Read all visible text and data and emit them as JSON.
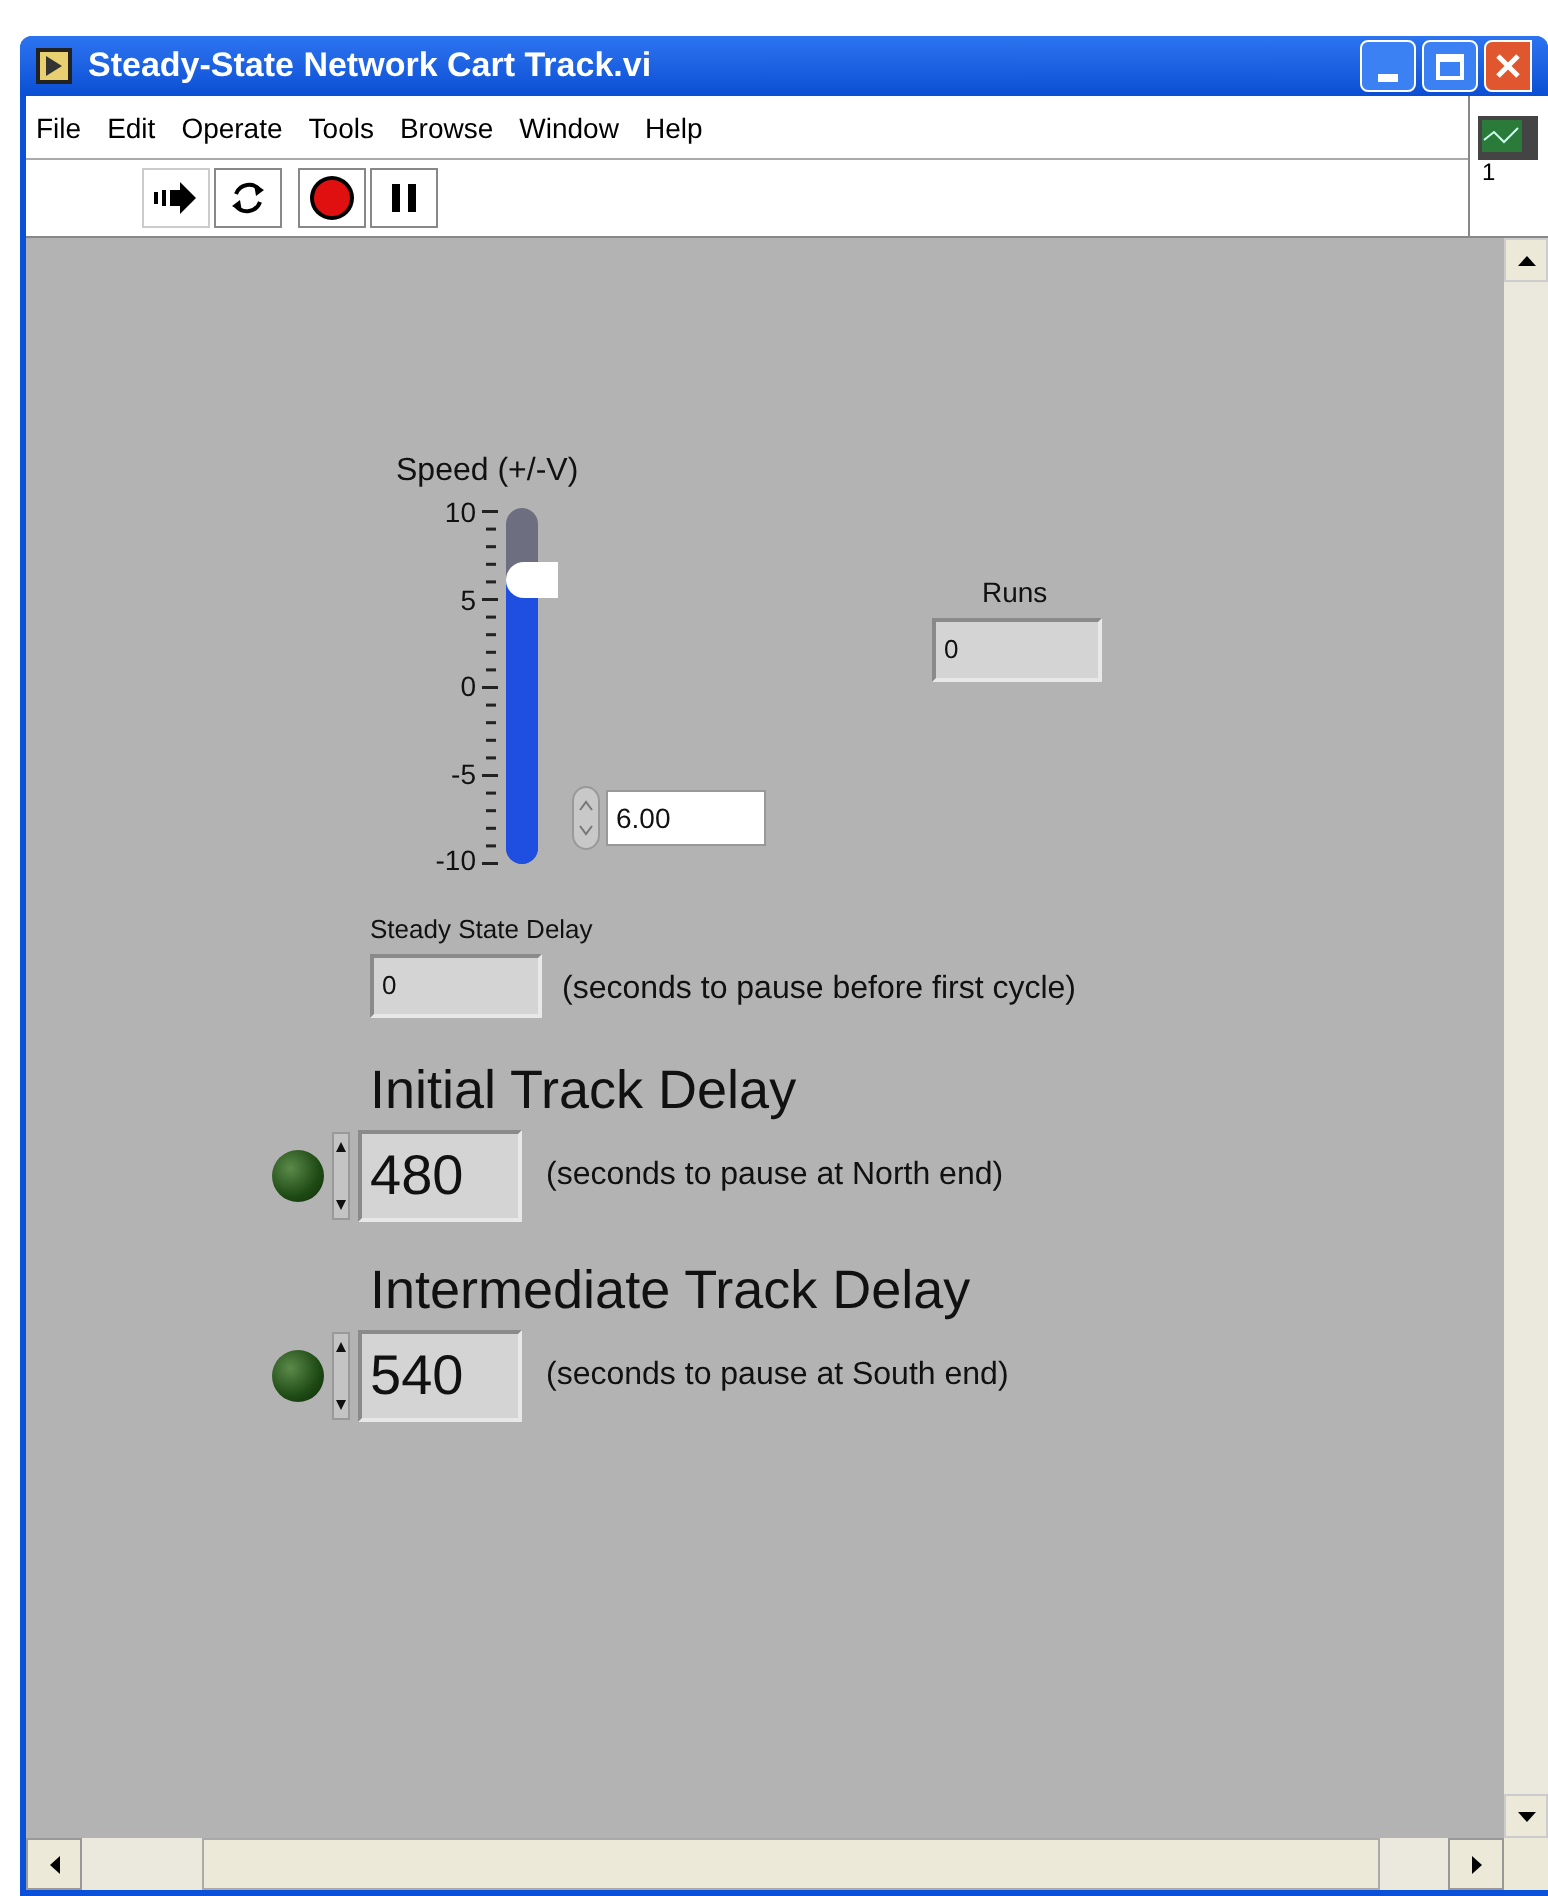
{
  "window": {
    "title": "Steady-State Network Cart Track.vi"
  },
  "menu": [
    "File",
    "Edit",
    "Operate",
    "Tools",
    "Browse",
    "Window",
    "Help"
  ],
  "connector_pane": {
    "label": "1"
  },
  "speed": {
    "label": "Speed (+/-V)",
    "level": 0.8,
    "scale": [
      "10",
      "5",
      "0",
      "-5",
      "-10"
    ],
    "value": "6.00"
  },
  "runs": {
    "label": "Runs",
    "value": "0"
  },
  "steady_state_delay": {
    "label": "Steady State Delay",
    "value": "0",
    "note": "(seconds to pause before first cycle)"
  },
  "delays": [
    {
      "title": "Initial Track Delay",
      "value": "480",
      "note": "(seconds to pause at North end)",
      "on": false
    },
    {
      "title": "Intermediate Track Delay",
      "value": "540",
      "note": "(seconds to pause at South end)",
      "on": false
    }
  ]
}
